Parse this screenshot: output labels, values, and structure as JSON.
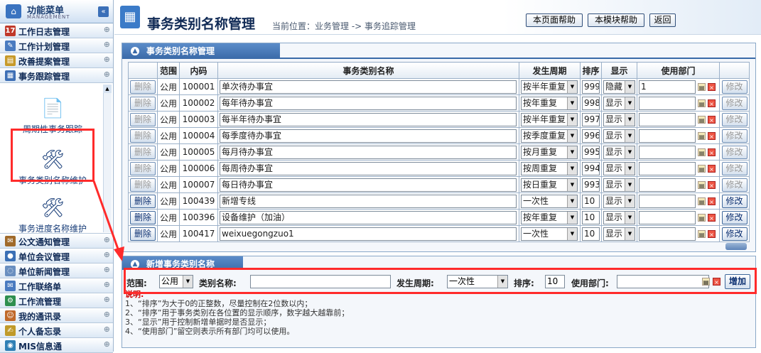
{
  "sidebar": {
    "header": {
      "title": "功能菜单",
      "subtitle": "MANAGEMENT",
      "collapse_icon": "«"
    },
    "menu_top": [
      {
        "label": "工作日志管理",
        "icon_color": "#c0392b",
        "icon_glyph": "17"
      },
      {
        "label": "工作计划管理",
        "icon_color": "#4a7bc0",
        "icon_glyph": "✎"
      },
      {
        "label": "改善提案管理",
        "icon_color": "#c79a2a",
        "icon_glyph": "▤"
      },
      {
        "label": "事务跟踪管理",
        "icon_color": "#3e6fb5",
        "icon_glyph": "▦"
      }
    ],
    "sub_items": [
      {
        "label": "周期性事务跟踪",
        "icon": "📄"
      },
      {
        "label": "事务类别名称维护",
        "icon": "🛠"
      },
      {
        "label": "事务进度名称维护",
        "icon": "🛠"
      }
    ],
    "menu_bottom": [
      {
        "label": "公文通知管理",
        "icon_color": "#a06a2a",
        "icon_glyph": "✉"
      },
      {
        "label": "单位会议管理",
        "icon_color": "#3a6fb5",
        "icon_glyph": "●"
      },
      {
        "label": "单位新闻管理",
        "icon_color": "#6a8fc0",
        "icon_glyph": "◌"
      },
      {
        "label": "工作联络单",
        "icon_color": "#4a7bc0",
        "icon_glyph": "✉"
      },
      {
        "label": "工作流管理",
        "icon_color": "#2f8f4f",
        "icon_glyph": "⚙"
      },
      {
        "label": "我的通讯录",
        "icon_color": "#c0692a",
        "icon_glyph": "☺"
      },
      {
        "label": "个人备忘录",
        "icon_color": "#c09a2a",
        "icon_glyph": "✍"
      },
      {
        "label": "MIS信息通",
        "icon_color": "#2f7fb5",
        "icon_glyph": "◉"
      }
    ],
    "expand_icon": "⊕"
  },
  "header": {
    "title": "事务类别名称管理",
    "breadcrumb": "当前位置：业务管理 -> 事务追踪管理",
    "buttons": [
      "本页面帮助",
      "本模块帮助",
      "返回"
    ]
  },
  "list_panel": {
    "title": "事务类别名称管理",
    "columns": [
      "",
      "范围",
      "内码",
      "事务类别名称",
      "发生周期",
      "排序",
      "显示",
      "使用部门",
      ""
    ],
    "rows": [
      {
        "delete": "删除",
        "scope": "公用",
        "code": "100001",
        "name": "单次待办事宜",
        "cycle": "按半年重复",
        "order": "999",
        "show": "隐藏",
        "dept": "1",
        "edit": "修改",
        "active": false
      },
      {
        "delete": "删除",
        "scope": "公用",
        "code": "100002",
        "name": "每年待办事宜",
        "cycle": "按年重复",
        "order": "998",
        "show": "显示",
        "dept": "",
        "edit": "修改",
        "active": false
      },
      {
        "delete": "删除",
        "scope": "公用",
        "code": "100003",
        "name": "每半年待办事宜",
        "cycle": "按半年重复",
        "order": "997",
        "show": "显示",
        "dept": "",
        "edit": "修改",
        "active": false
      },
      {
        "delete": "删除",
        "scope": "公用",
        "code": "100004",
        "name": "每季度待办事宜",
        "cycle": "按季度重复",
        "order": "996",
        "show": "显示",
        "dept": "",
        "edit": "修改",
        "active": false
      },
      {
        "delete": "删除",
        "scope": "公用",
        "code": "100005",
        "name": "每月待办事宜",
        "cycle": "按月重复",
        "order": "995",
        "show": "显示",
        "dept": "",
        "edit": "修改",
        "active": false
      },
      {
        "delete": "删除",
        "scope": "公用",
        "code": "100006",
        "name": "每周待办事宜",
        "cycle": "按周重复",
        "order": "994",
        "show": "显示",
        "dept": "",
        "edit": "修改",
        "active": false
      },
      {
        "delete": "删除",
        "scope": "公用",
        "code": "100007",
        "name": "每日待办事宜",
        "cycle": "按日重复",
        "order": "993",
        "show": "显示",
        "dept": "",
        "edit": "修改",
        "active": false
      },
      {
        "delete": "删除",
        "scope": "公用",
        "code": "100439",
        "name": "新增专线",
        "cycle": "一次性",
        "order": "10",
        "show": "显示",
        "dept": "",
        "edit": "修改",
        "active": true
      },
      {
        "delete": "删除",
        "scope": "公用",
        "code": "100396",
        "name": "设备维护（加油）",
        "cycle": "按年重复",
        "order": "10",
        "show": "显示",
        "dept": "",
        "edit": "修改",
        "active": true
      },
      {
        "delete": "删除",
        "scope": "公用",
        "code": "100417",
        "name": "weixuegongzuo1",
        "cycle": "一次性",
        "order": "10",
        "show": "显示",
        "dept": "",
        "edit": "修改",
        "active": true
      }
    ]
  },
  "new_panel": {
    "title": "新增事务类别名称",
    "scope_label": "范围:",
    "scope_value": "公用",
    "name_label": "类别名称:",
    "name_value": "",
    "cycle_label": "发生周期:",
    "cycle_value": "一次性",
    "order_label": "排序:",
    "order_value": "10",
    "dept_label": "使用部门:",
    "dept_value": "",
    "add_button": "增加",
    "notes_title": "说明:",
    "notes": [
      "1、“排序”为大于0的正整数，尽量控制在2位数以内；",
      "2、“排序”用于事务类别在各位置的显示顺序，数字越大越靠前；",
      "3、“显示”用于控制新增单据时是否显示；",
      "4、“使用部门”留空则表示所有部门均可以使用。"
    ]
  },
  "colors": {
    "highlight": "#ff2b2b",
    "panel_title": "#3a6aa8"
  }
}
